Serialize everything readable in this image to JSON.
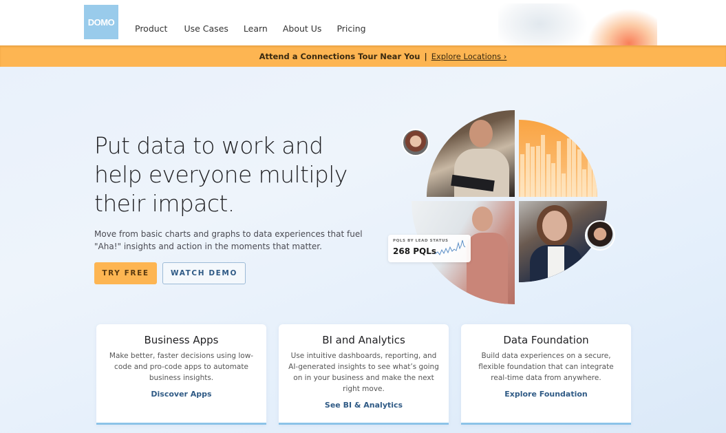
{
  "header": {
    "logo_text": "DOMO",
    "nav": [
      "Product",
      "Use Cases",
      "Learn",
      "About Us",
      "Pricing"
    ]
  },
  "banner": {
    "text": "Attend a Connections Tour Near You",
    "separator": "|",
    "link_label": "Explore Locations ›"
  },
  "hero": {
    "title": "Put data to work and help everyone multiply their impact.",
    "subtitle": "Move from basic charts and graphs to data experiences that fuel \"Aha!\" insights and action in the moments that matter.",
    "try_free_label": "TRY FREE",
    "watch_demo_label": "WATCH DEMO",
    "pql_widget": {
      "label": "PQLS BY LEAD STATUS",
      "value": "268 PQLs"
    }
  },
  "cards": [
    {
      "title": "Business Apps",
      "description": "Make better, faster decisions using low-code and pro-code apps to automate business insights.",
      "link": "Discover Apps"
    },
    {
      "title": "BI and Analytics",
      "description": "Use intuitive dashboards, reporting, and AI-generated insights to see what’s going on in your business and make the next right move.",
      "link": "See BI & Analytics"
    },
    {
      "title": "Data Foundation",
      "description": "Build data experiences on a secure, flexible foundation that can integrate real-time data from anywhere.",
      "link": "Explore Foundation"
    }
  ],
  "colors": {
    "accent_orange": "#fdb552",
    "link_blue": "#2f5a85",
    "logo_blue": "#99cbeb"
  }
}
